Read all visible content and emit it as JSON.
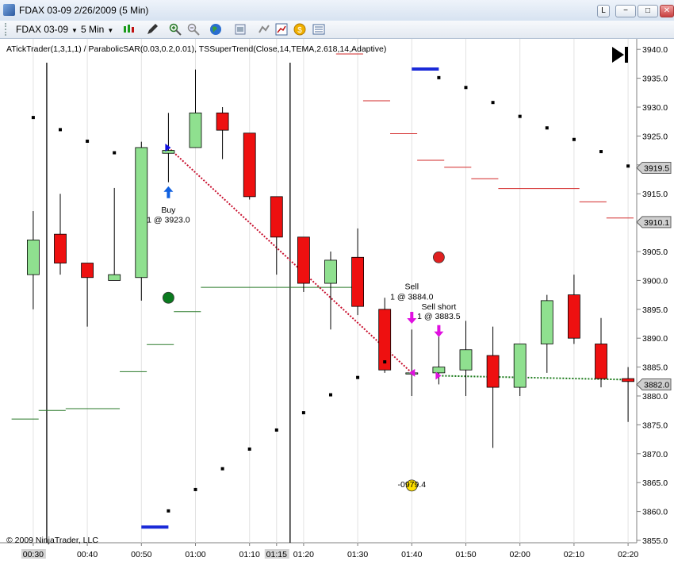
{
  "window": {
    "title": "FDAX 03-09  2/26/2009 (5 Min)",
    "buttons": [
      "L",
      "−",
      "□",
      "✕"
    ]
  },
  "toolbar": {
    "instrument": "FDAX 03-09",
    "interval": "5 Min"
  },
  "chart_data": {
    "type": "candlestick",
    "title": "ATickTrader(1,3,1,1) / ParabolicSAR(0.03,0.2,0.01), TSSuperTrend(Close,14,TEMA,2.618,14,Adaptive)",
    "copyright": "© 2009 NinjaTrader, LLC",
    "ylim": [
      3855,
      3941
    ],
    "xlim": [
      0,
      22.7
    ],
    "yticks": [
      3940,
      3935,
      3930,
      3925,
      3920,
      3915,
      3910,
      3905,
      3900,
      3895,
      3890,
      3885,
      3880,
      3875,
      3870,
      3865,
      3860,
      3855
    ],
    "y_tick_labels": [
      "3940.0",
      "3935.0",
      "3930.0",
      "3925.0",
      "3920.0",
      "3915.0",
      "3910.0",
      "3905.0",
      "3900.0",
      "3895.0",
      "3890.0",
      "3885.0",
      "3880.0",
      "3875.0",
      "3870.0",
      "3865.0",
      "3860.0",
      "3855.0"
    ],
    "xticks": [
      {
        "i": 1,
        "label": "00:30",
        "highlight": true
      },
      {
        "i": 3,
        "label": "00:40",
        "highlight": false
      },
      {
        "i": 5,
        "label": "00:50",
        "highlight": false
      },
      {
        "i": 7,
        "label": "01:00",
        "highlight": false
      },
      {
        "i": 9,
        "label": "01:10",
        "highlight": false
      },
      {
        "i": 10,
        "label": "01:15",
        "highlight": true
      },
      {
        "i": 11,
        "label": "01:20",
        "highlight": false
      },
      {
        "i": 13,
        "label": "01:30",
        "highlight": false
      },
      {
        "i": 15,
        "label": "01:40",
        "highlight": false
      },
      {
        "i": 17,
        "label": "01:50",
        "highlight": false
      },
      {
        "i": 19,
        "label": "02:00",
        "highlight": false
      },
      {
        "i": 21,
        "label": "02:10",
        "highlight": false
      },
      {
        "i": 23,
        "label": "02:20",
        "highlight": false
      }
    ],
    "vlines": [
      1.5,
      10.5
    ],
    "candles": [
      {
        "i": 1,
        "o": 3901,
        "h": 3912,
        "l": 3895,
        "c": 3907
      },
      {
        "i": 2,
        "o": 3908,
        "h": 3915,
        "l": 3901,
        "c": 3903
      },
      {
        "i": 3,
        "o": 3903,
        "h": 3903,
        "l": 3892,
        "c": 3900.5
      },
      {
        "i": 4,
        "o": 3900,
        "h": 3916,
        "l": 3900,
        "c": 3901
      },
      {
        "i": 5,
        "o": 3900.5,
        "h": 3924,
        "l": 3896.5,
        "c": 3923
      },
      {
        "i": 6,
        "o": 3922,
        "h": 3929,
        "l": 3917,
        "c": 3922.5
      },
      {
        "i": 7,
        "o": 3923,
        "h": 3936.5,
        "l": 3923,
        "c": 3929
      },
      {
        "i": 8,
        "o": 3929,
        "h": 3930,
        "l": 3921,
        "c": 3926
      },
      {
        "i": 9,
        "o": 3925.5,
        "h": 3925.5,
        "l": 3914,
        "c": 3914.5
      },
      {
        "i": 10,
        "o": 3914.5,
        "h": 3914.5,
        "l": 3901,
        "c": 3907.5
      },
      {
        "i": 11,
        "o": 3907.5,
        "h": 3907.5,
        "l": 3898,
        "c": 3899.5
      },
      {
        "i": 12,
        "o": 3899.5,
        "h": 3905,
        "l": 3891.5,
        "c": 3903.5
      },
      {
        "i": 13,
        "o": 3904,
        "h": 3909,
        "l": 3894,
        "c": 3895.5
      },
      {
        "i": 14,
        "o": 3895,
        "h": 3897,
        "l": 3884,
        "c": 3884.5
      },
      {
        "i": 15,
        "o": 3884,
        "h": 3891.5,
        "l": 3880,
        "c": 3884
      },
      {
        "i": 16,
        "o": 3884,
        "h": 3890.5,
        "l": 3882,
        "c": 3885
      },
      {
        "i": 17,
        "o": 3884.5,
        "h": 3893,
        "l": 3880,
        "c": 3888
      },
      {
        "i": 18,
        "o": 3887,
        "h": 3892,
        "l": 3871,
        "c": 3881.5
      },
      {
        "i": 19,
        "o": 3881.5,
        "h": 3889,
        "l": 3880,
        "c": 3889
      },
      {
        "i": 20,
        "o": 3889,
        "h": 3897.5,
        "l": 3884,
        "c": 3896.5
      },
      {
        "i": 21,
        "o": 3897.5,
        "h": 3901,
        "l": 3889,
        "c": 3890
      },
      {
        "i": 22,
        "o": 3889,
        "h": 3893.5,
        "l": 3881.5,
        "c": 3883
      },
      {
        "i": 23,
        "o": 3883,
        "h": 3885,
        "l": 3875.5,
        "c": 3882.5
      }
    ],
    "sar_dots": [
      {
        "i": 1,
        "y": 3928.2
      },
      {
        "i": 2,
        "y": 3926.1
      },
      {
        "i": 3,
        "y": 3924.1
      },
      {
        "i": 4,
        "y": 3922.1
      },
      {
        "i": 6,
        "y": 3860.1
      },
      {
        "i": 7,
        "y": 3863.8
      },
      {
        "i": 8,
        "y": 3867.4
      },
      {
        "i": 9,
        "y": 3870.8
      },
      {
        "i": 10,
        "y": 3874.1
      },
      {
        "i": 11,
        "y": 3877.1
      },
      {
        "i": 12,
        "y": 3880.2
      },
      {
        "i": 13,
        "y": 3883.2
      },
      {
        "i": 14,
        "y": 3885.9
      },
      {
        "i": 16,
        "y": 3935.1
      },
      {
        "i": 17,
        "y": 3933.4
      },
      {
        "i": 18,
        "y": 3930.8
      },
      {
        "i": 19,
        "y": 3928.4
      },
      {
        "i": 20,
        "y": 3926.4
      },
      {
        "i": 21,
        "y": 3924.4
      },
      {
        "i": 22,
        "y": 3922.3
      },
      {
        "i": 23,
        "y": 3919.8
      }
    ],
    "supertrend_up": [
      {
        "x1": 0.2,
        "x2": 1.2,
        "y": 3876
      },
      {
        "x1": 1.2,
        "x2": 2.2,
        "y": 3877.5
      },
      {
        "x1": 2.2,
        "x2": 4.2,
        "y": 3877.8
      },
      {
        "x1": 4.2,
        "x2": 5.2,
        "y": 3884.2
      },
      {
        "x1": 5.2,
        "x2": 6.2,
        "y": 3888.9
      },
      {
        "x1": 6.2,
        "x2": 7.2,
        "y": 3894.6
      },
      {
        "x1": 7.2,
        "x2": 12.8,
        "y": 3898.8
      }
    ],
    "supertrend_down": [
      {
        "x1": 12.2,
        "x2": 13.2,
        "y": 3939.2
      },
      {
        "x1": 13.2,
        "x2": 14.2,
        "y": 3931.1
      },
      {
        "x1": 14.2,
        "x2": 15.2,
        "y": 3925.4
      },
      {
        "x1": 15.2,
        "x2": 16.2,
        "y": 3920.8
      },
      {
        "x1": 16.2,
        "x2": 17.2,
        "y": 3919.6
      },
      {
        "x1": 17.2,
        "x2": 18.2,
        "y": 3917.6
      },
      {
        "x1": 18.2,
        "x2": 21.2,
        "y": 3915.9
      },
      {
        "x1": 21.2,
        "x2": 22.2,
        "y": 3913.6
      },
      {
        "x1": 22.2,
        "x2": 23.2,
        "y": 3910.8
      }
    ],
    "blue_bars": [
      {
        "x1": 5.0,
        "x2": 6.0,
        "y": 3857.3
      },
      {
        "x1": 15.0,
        "x2": 16.0,
        "y": 3936.6
      }
    ],
    "circles": [
      {
        "i": 6,
        "y": 3897,
        "color": "#0a7a1e"
      },
      {
        "i": 16,
        "y": 3904,
        "color": "#e02020"
      },
      {
        "i": 15,
        "y": 3864.5,
        "color": "#ffe000"
      }
    ],
    "trade_lines": [
      {
        "x1": 6,
        "y1": 3923,
        "x2": 15,
        "y2": 3884,
        "color": "#c8102e"
      },
      {
        "x1": 16,
        "y1": 3883.5,
        "x2": 23.2,
        "y2": 3882.8,
        "color": "#1a7a1a"
      }
    ],
    "markers": [
      {
        "i": 6,
        "y": 3923,
        "color": "#1010e0",
        "dir": "right"
      },
      {
        "i": 15,
        "y": 3884,
        "color": "#e010e0",
        "dir": "left"
      },
      {
        "i": 16,
        "y": 3883.5,
        "color": "#e010e0",
        "dir": "right"
      }
    ],
    "arrows": [
      {
        "i": 6,
        "y": 3915.2,
        "dir": "up",
        "color": "#1060e0"
      },
      {
        "i": 15,
        "y": 3893.6,
        "dir": "down",
        "color": "#e010e0"
      },
      {
        "i": 16,
        "y": 3891.3,
        "dir": "down",
        "color": "#e010e0"
      }
    ],
    "annotations": [
      {
        "i": 6,
        "y": 3911.7,
        "text": "Buy"
      },
      {
        "i": 6,
        "y": 3910.0,
        "text": "1 @ 3923.0"
      },
      {
        "i": 15,
        "y": 3898.5,
        "text": "Sell"
      },
      {
        "i": 15,
        "y": 3896.7,
        "text": "1 @ 3884.0"
      },
      {
        "i": 16,
        "y": 3895.0,
        "text": "Sell short"
      },
      {
        "i": 16,
        "y": 3893.3,
        "text": "1 @ 3883.5"
      },
      {
        "i": 15,
        "y": 3864.2,
        "text": "-0979.4"
      }
    ],
    "price_labels": [
      {
        "y": 3919.5,
        "text": "3919.5",
        "bg": "#cfcfcf"
      },
      {
        "y": 3910.1,
        "text": "3910.1",
        "bg": "#cfcfcf"
      },
      {
        "y": 3882.0,
        "text": "3882.0",
        "bg": "#cfcfcf"
      }
    ]
  }
}
